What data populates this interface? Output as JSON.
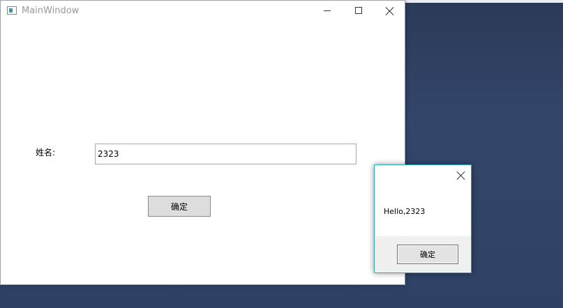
{
  "main_window": {
    "title": "MainWindow",
    "icons": {
      "app": "window-app-icon",
      "minimize": "minimize-icon",
      "maximize": "maximize-icon",
      "close": "close-icon"
    },
    "form": {
      "name_label": "姓名:",
      "name_value": "2323",
      "confirm_label": "确定"
    }
  },
  "message_box": {
    "message": "Hello,2323",
    "ok_label": "确定",
    "icons": {
      "close": "close-icon"
    },
    "accent_color": "#26b5b5"
  },
  "desktop": {
    "background_color": "#2f4266"
  }
}
